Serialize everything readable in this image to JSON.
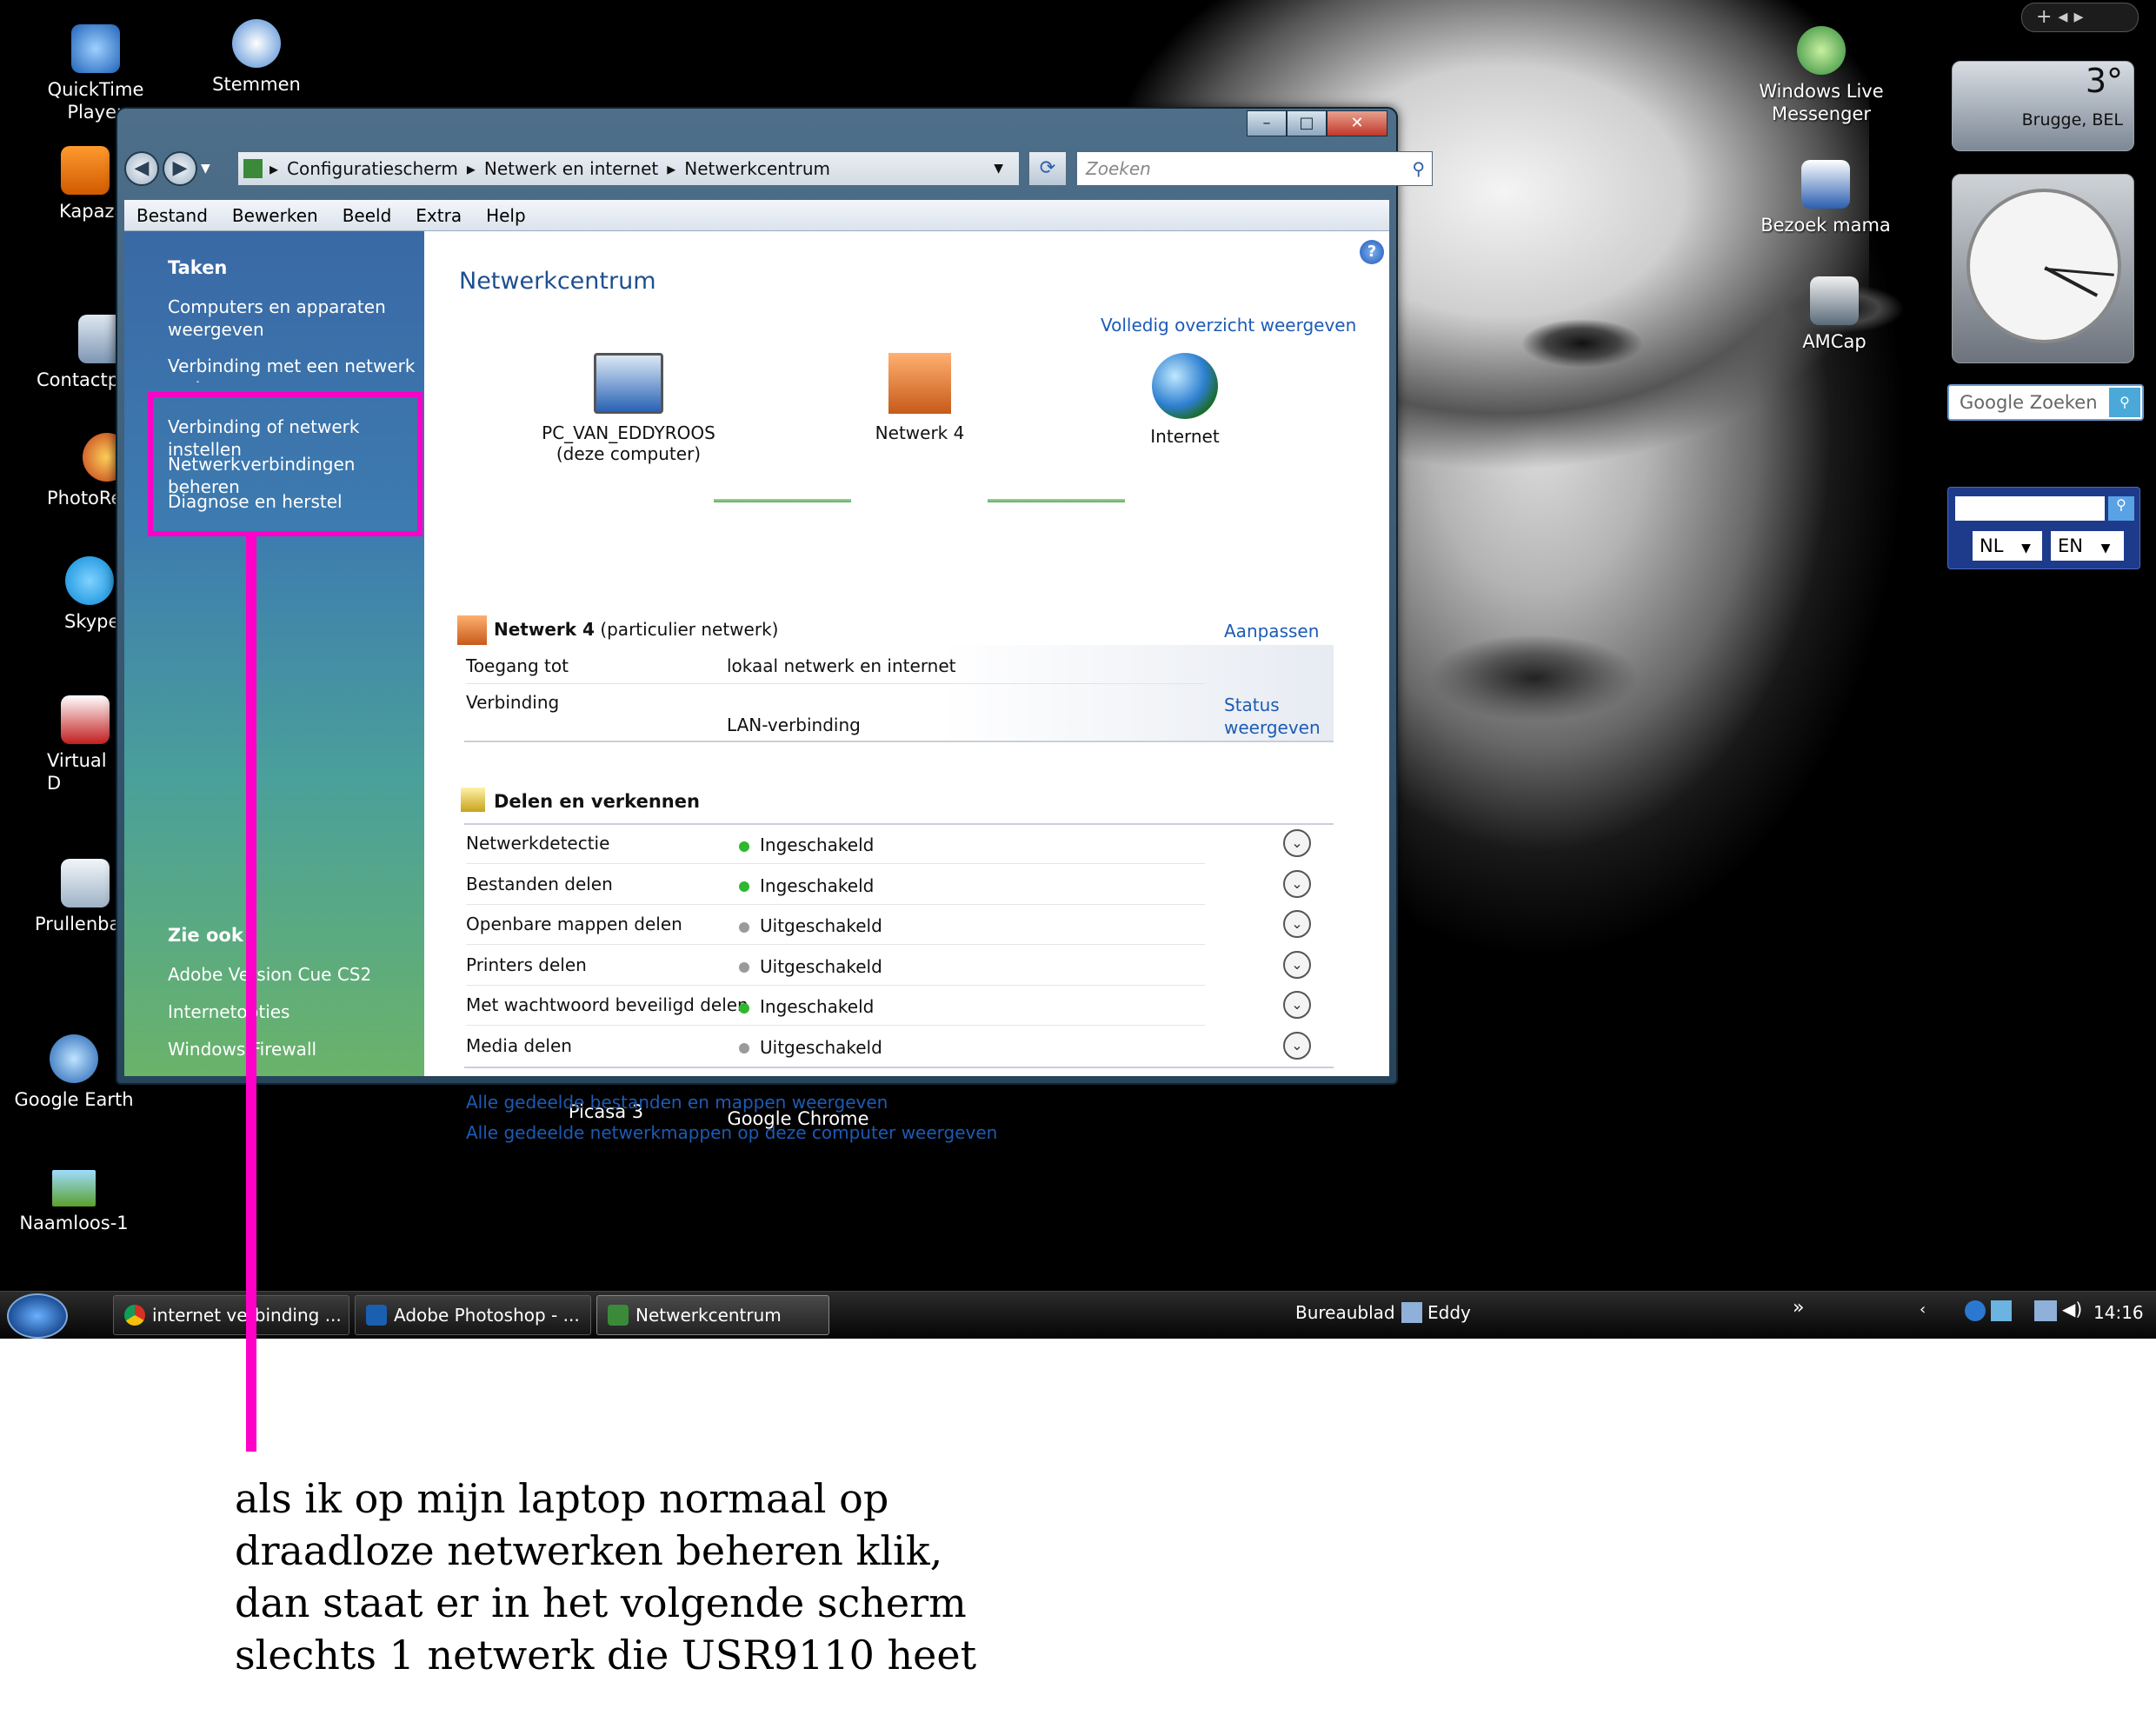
{
  "desktop": {
    "icons": [
      {
        "label": "QuickTime Player"
      },
      {
        "label": "Stemmen"
      },
      {
        "label": "Kapaza"
      },
      {
        "label": "Contactp"
      },
      {
        "label": "PhotoRe"
      },
      {
        "label": "Skype"
      },
      {
        "label": "Virtual D"
      },
      {
        "label": "Prullenba"
      },
      {
        "label": "Google Earth"
      },
      {
        "label": "Naamloos-1"
      },
      {
        "label": "Picasa 3"
      },
      {
        "label": "Google Chrome"
      },
      {
        "label": "Windows Live Messenger"
      },
      {
        "label": "Bezoek mama"
      },
      {
        "label": "AMCap"
      }
    ],
    "weather": {
      "temp": "3°",
      "location": "Brugge, BEL"
    },
    "google_search": {
      "placeholder": "Google Zoeken"
    },
    "translator": {
      "from": "NL",
      "to": "EN"
    }
  },
  "window": {
    "address": {
      "crumbs": [
        "Configuratiescherm",
        "Netwerk en internet",
        "Netwerkcentrum"
      ],
      "search_placeholder": "Zoeken"
    },
    "menu": [
      "Bestand",
      "Bewerken",
      "Beeld",
      "Extra",
      "Help"
    ],
    "sidebar": {
      "tasks_header": "Taken",
      "tasks": [
        "Computers en apparaten weergeven",
        "Verbinding met een netwerk maken",
        "Verbinding of netwerk instellen",
        "Netwerkverbindingen beheren",
        "Diagnose en herstel"
      ],
      "see_also_header": "Zie ook",
      "see_also": [
        "Adobe Version Cue CS2",
        "Internetopties",
        "Windows Firewall"
      ]
    },
    "content": {
      "title": "Netwerkcentrum",
      "full_map_link": "Volledig overzicht weergeven",
      "map": {
        "computer_name": "PC_VAN_EDDYROOS",
        "computer_sub": "(deze computer)",
        "network": "Netwerk  4",
        "internet": "Internet"
      },
      "network_section": {
        "name": "Netwerk  4",
        "type": "(particulier netwerk)",
        "customize": "Aanpassen",
        "access_label": "Toegang tot",
        "access_value": "lokaal netwerk en internet",
        "connection_label": "Verbinding",
        "connection_value": "LAN-verbinding",
        "status_link_1": "Status",
        "status_link_2": "weergeven"
      },
      "sharing_section": {
        "title": "Delen en verkennen",
        "rows": [
          {
            "label": "Netwerkdetectie",
            "value": "Ingeschakeld",
            "on": true
          },
          {
            "label": "Bestanden delen",
            "value": "Ingeschakeld",
            "on": true
          },
          {
            "label": "Openbare mappen delen",
            "value": "Uitgeschakeld",
            "on": false
          },
          {
            "label": "Printers delen",
            "value": "Uitgeschakeld",
            "on": false
          },
          {
            "label": "Met wachtwoord beveiligd delen",
            "value": "Ingeschakeld",
            "on": true
          },
          {
            "label": "Media delen",
            "value": "Uitgeschakeld",
            "on": false
          }
        ]
      },
      "bottom_links": [
        "Alle gedeelde bestanden en mappen weergeven",
        "Alle gedeelde netwerkmappen op deze computer weergeven"
      ]
    }
  },
  "taskbar": {
    "buttons": [
      "internet verbinding ...",
      "Adobe Photoshop - ...",
      "Netwerkcentrum"
    ],
    "toolbar_label": "Bureaublad",
    "user": "Eddy",
    "time": "14:16"
  },
  "annotation": {
    "lines": [
      "als ik op mijn laptop normaal op",
      "draadloze netwerken beheren klik,",
      "dan staat er in het volgende scherm",
      "slechts 1 netwerk die USR9110 heet"
    ]
  },
  "colors": {
    "highlight": "#ff00c8",
    "link": "#1c5bb5",
    "status_on": "#2db82d",
    "status_off": "#9a9a9a"
  }
}
